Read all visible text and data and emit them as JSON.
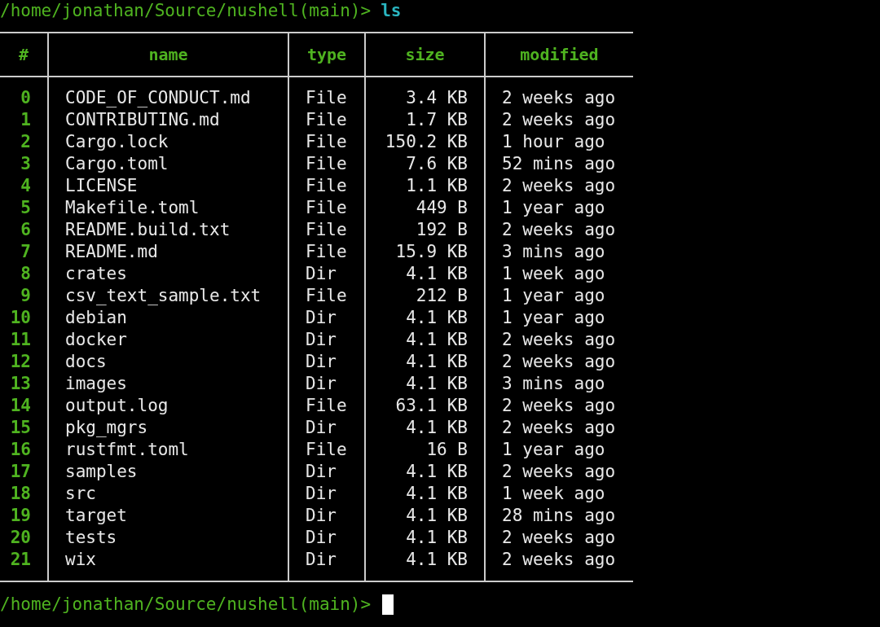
{
  "prompts": [
    {
      "path": "/home/jonathan/Source/nushell(main)>",
      "command": "ls"
    }
  ],
  "table": {
    "columns": [
      {
        "label": "#",
        "kind": "index"
      },
      {
        "label": "name",
        "kind": "text"
      },
      {
        "label": "type",
        "kind": "text"
      },
      {
        "label": "size",
        "kind": "number"
      },
      {
        "label": "modified",
        "kind": "text"
      }
    ],
    "rows": [
      [
        "0",
        "CODE_OF_CONDUCT.md",
        "File",
        "3.4 KB",
        "2 weeks ago"
      ],
      [
        "1",
        "CONTRIBUTING.md",
        "File",
        "1.7 KB",
        "2 weeks ago"
      ],
      [
        "2",
        "Cargo.lock",
        "File",
        "150.2 KB",
        "1 hour ago"
      ],
      [
        "3",
        "Cargo.toml",
        "File",
        "7.6 KB",
        "52 mins ago"
      ],
      [
        "4",
        "LICENSE",
        "File",
        "1.1 KB",
        "2 weeks ago"
      ],
      [
        "5",
        "Makefile.toml",
        "File",
        "449 B",
        "1 year ago"
      ],
      [
        "6",
        "README.build.txt",
        "File",
        "192 B",
        "2 weeks ago"
      ],
      [
        "7",
        "README.md",
        "File",
        "15.9 KB",
        "3 mins ago"
      ],
      [
        "8",
        "crates",
        "Dir",
        "4.1 KB",
        "1 week ago"
      ],
      [
        "9",
        "csv_text_sample.txt",
        "File",
        "212 B",
        "1 year ago"
      ],
      [
        "10",
        "debian",
        "Dir",
        "4.1 KB",
        "1 year ago"
      ],
      [
        "11",
        "docker",
        "Dir",
        "4.1 KB",
        "2 weeks ago"
      ],
      [
        "12",
        "docs",
        "Dir",
        "4.1 KB",
        "2 weeks ago"
      ],
      [
        "13",
        "images",
        "Dir",
        "4.1 KB",
        "3 mins ago"
      ],
      [
        "14",
        "output.log",
        "File",
        "63.1 KB",
        "2 weeks ago"
      ],
      [
        "15",
        "pkg_mgrs",
        "Dir",
        "4.1 KB",
        "2 weeks ago"
      ],
      [
        "16",
        "rustfmt.toml",
        "File",
        "16 B",
        "1 year ago"
      ],
      [
        "17",
        "samples",
        "Dir",
        "4.1 KB",
        "2 weeks ago"
      ],
      [
        "18",
        "src",
        "Dir",
        "4.1 KB",
        "1 week ago"
      ],
      [
        "19",
        "target",
        "Dir",
        "4.1 KB",
        "28 mins ago"
      ],
      [
        "20",
        "tests",
        "Dir",
        "4.1 KB",
        "2 weeks ago"
      ],
      [
        "21",
        "wix",
        "Dir",
        "4.1 KB",
        "2 weeks ago"
      ]
    ]
  },
  "current_prompt": {
    "path": "/home/jonathan/Source/nushell(main)>"
  }
}
